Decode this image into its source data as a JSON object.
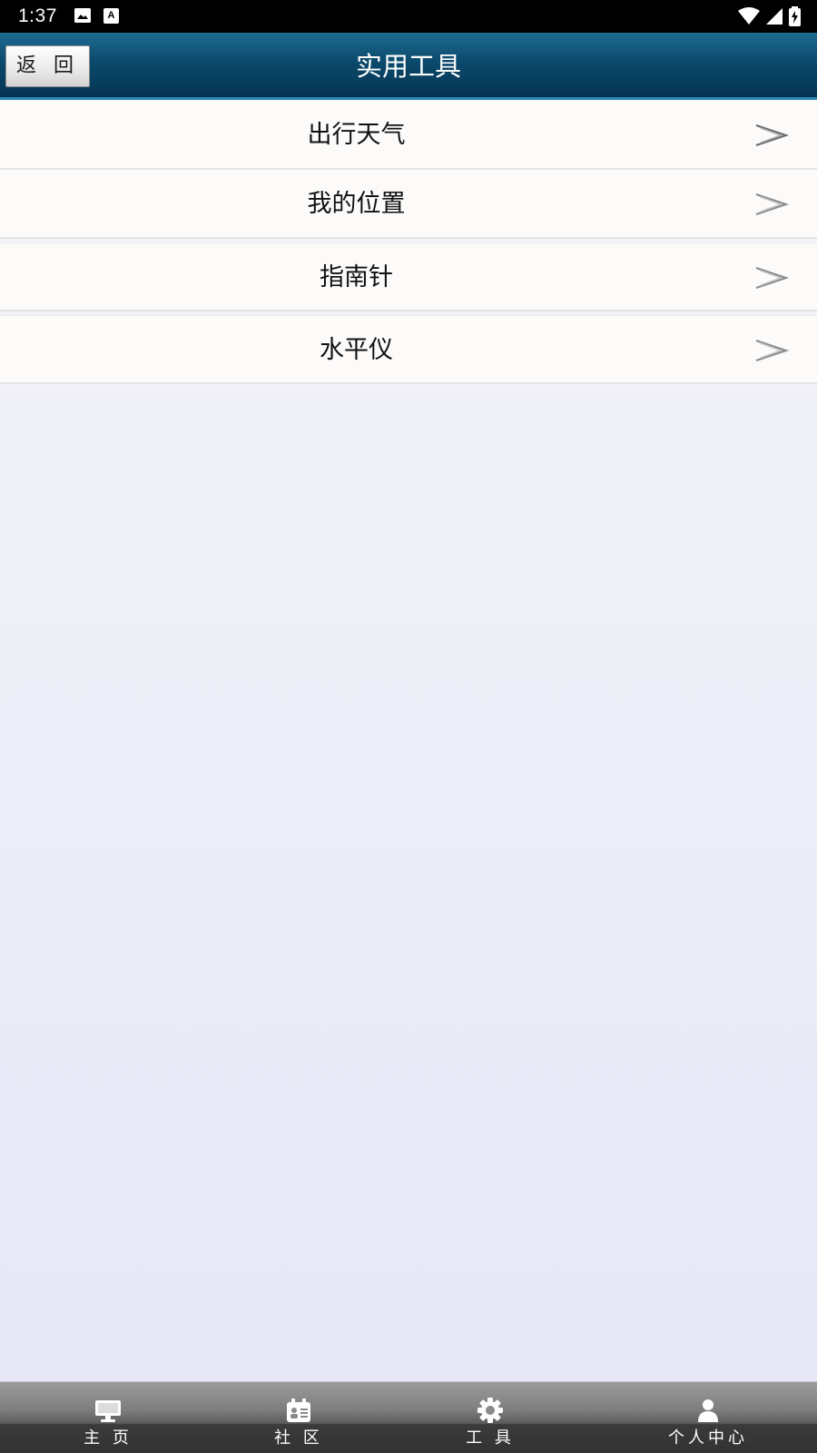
{
  "status_bar": {
    "time": "1:37",
    "icons": [
      "image-icon",
      "a-icon",
      "wifi-icon",
      "signal-icon",
      "battery-icon"
    ]
  },
  "header": {
    "back_label": "返 回",
    "title": "实用工具",
    "color": "#0b4a6c"
  },
  "tools": [
    {
      "label": "出行天气",
      "icon": "chevron-right-icon"
    },
    {
      "label": "我的位置",
      "icon": "chevron-right-icon"
    },
    {
      "label": "指南针",
      "icon": "chevron-right-icon"
    },
    {
      "label": "水平仪",
      "icon": "chevron-right-icon"
    }
  ],
  "tab_bar": {
    "tabs": [
      {
        "label": "主 页",
        "icon": "monitor-icon"
      },
      {
        "label": "社 区",
        "icon": "community-icon"
      },
      {
        "label": "工 具",
        "icon": "gear-icon"
      },
      {
        "label": "个人中心",
        "icon": "person-icon"
      }
    ]
  }
}
